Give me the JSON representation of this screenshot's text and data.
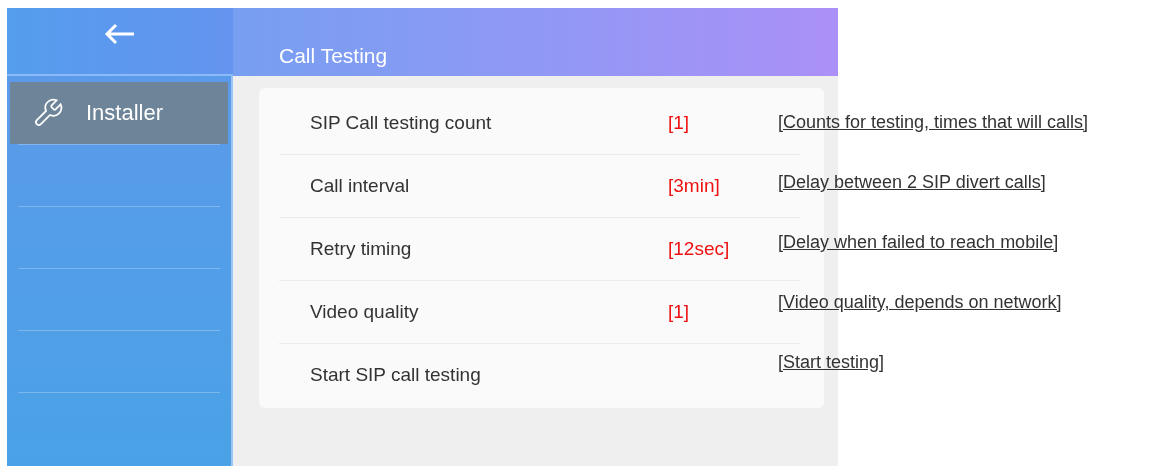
{
  "sidebar": {
    "items": [
      {
        "label": "Installer",
        "selected": true
      }
    ]
  },
  "header": {
    "title": "Call Testing"
  },
  "settings": [
    {
      "label": "SIP Call testing count",
      "value": "[1]"
    },
    {
      "label": "Call interval",
      "value": "[3min]"
    },
    {
      "label": "Retry timing",
      "value": "[12sec]"
    },
    {
      "label": "Video quality",
      "value": "[1]"
    },
    {
      "label": "Start SIP call testing"
    }
  ],
  "annotations": [
    "[Counts for testing, times that will calls]",
    "[Delay between 2 SIP divert calls]",
    "[Delay when failed to reach mobile]",
    "[Video quality, depends on network]",
    "[Start testing]"
  ]
}
